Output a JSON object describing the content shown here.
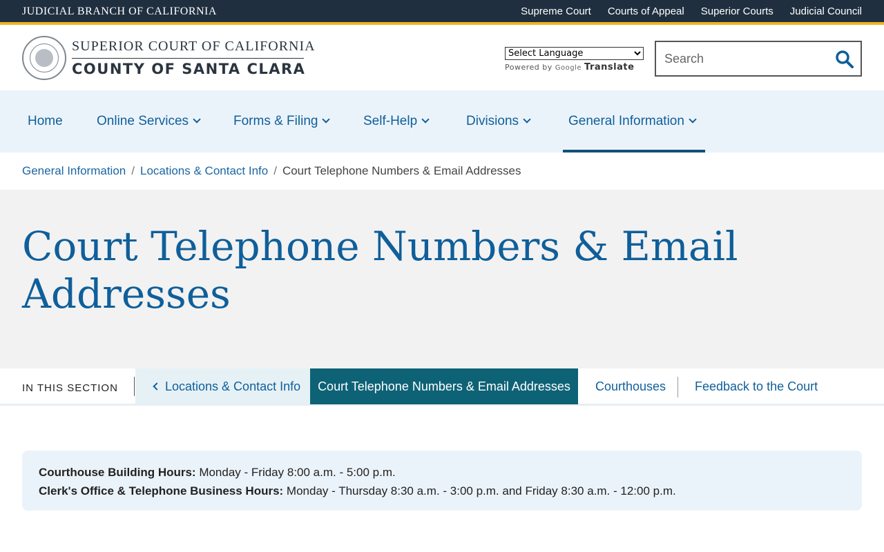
{
  "topbar": {
    "brand": "JUDICIAL BRANCH OF CALIFORNIA",
    "links": [
      "Supreme Court",
      "Courts of Appeal",
      "Superior Courts",
      "Judicial Council"
    ]
  },
  "header": {
    "logo_line1": "SUPERIOR COURT OF CALIFORNIA",
    "logo_line2": "COUNTY OF SANTA CLARA",
    "language_select": "Select Language",
    "powered_by": "Powered by",
    "google_label": "Google",
    "translate_label": "Translate",
    "search_placeholder": "Search"
  },
  "nav": {
    "items": [
      {
        "label": "Home"
      },
      {
        "label": "Online Services"
      },
      {
        "label": "Forms & Filing"
      },
      {
        "label": "Self-Help"
      },
      {
        "label": "Divisions"
      },
      {
        "label": "General Information"
      }
    ]
  },
  "breadcrumb": {
    "items": [
      "General Information",
      "Locations & Contact Info",
      "Court Telephone Numbers & Email Addresses"
    ],
    "separator": "/"
  },
  "page": {
    "title": "Court Telephone Numbers & Email Addresses"
  },
  "section_nav": {
    "label": "IN THIS SECTION",
    "back": "Locations & Contact Info",
    "current": "Court Telephone Numbers & Email Addresses",
    "links": [
      "Courthouses",
      "Feedback to the Court"
    ]
  },
  "hours": {
    "building_label": "Courthouse Building Hours:",
    "building_value": " Monday - Friday 8:00 a.m. - 5:00 p.m.",
    "clerk_label": "Clerk's Office & Telephone Business Hours:",
    "clerk_value": " Monday - Thursday 8:30 a.m. - 3:00 p.m. and Friday  8:30 a.m. - 12:00 p.m."
  },
  "colors": {
    "topbar": "#1f2f3f",
    "accent_gold": "#f0b323",
    "link_blue": "#0f5f9a",
    "teal_active": "#0e6276",
    "nav_bg": "#ebf3fa"
  }
}
